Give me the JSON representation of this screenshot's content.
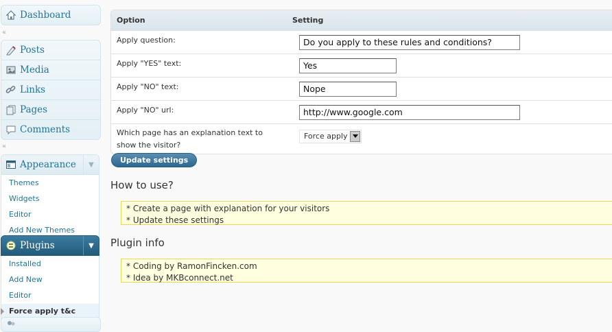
{
  "sidebar": {
    "dashboard": "Dashboard",
    "main_items": [
      {
        "label": "Posts",
        "icon": "posts-icon"
      },
      {
        "label": "Media",
        "icon": "media-icon"
      },
      {
        "label": "Links",
        "icon": "links-icon"
      },
      {
        "label": "Pages",
        "icon": "pages-icon"
      },
      {
        "label": "Comments",
        "icon": "comments-icon"
      }
    ],
    "appearance": {
      "label": "Appearance",
      "items": [
        "Themes",
        "Widgets",
        "Editor",
        "Add New Themes"
      ]
    },
    "plugins": {
      "label": "Plugins",
      "items": [
        "Installed",
        "Add New",
        "Editor",
        "Force apply t&c"
      ]
    },
    "separator_glyph": "«"
  },
  "table": {
    "header_option": "Option",
    "header_setting": "Setting",
    "rows": [
      {
        "label": "Apply question:",
        "value": "Do you apply to these rules and conditions?"
      },
      {
        "label": "Apply \"YES\" text:",
        "value": "Yes"
      },
      {
        "label": "Apply \"NO\" text:",
        "value": "Nope"
      },
      {
        "label": "Apply \"NO\" url:",
        "value": "http://www.google.com"
      },
      {
        "label": "Which page has an explanation text to show the visitor?",
        "value": "Force apply"
      }
    ]
  },
  "update_button": "Update settings",
  "how_to": {
    "title": "How to use?",
    "lines": [
      "* Create a page with explanation for your visitors",
      "* Update these settings"
    ]
  },
  "plugin_info": {
    "title": "Plugin info",
    "lines": [
      "* Coding by RamonFincken.com",
      "* Idea by MKBconnect.net"
    ]
  },
  "colors": {
    "link": "#21759b",
    "active_menu": "#2d6790",
    "notice_bg": "#ffffe0",
    "notice_border": "#e6db55"
  }
}
